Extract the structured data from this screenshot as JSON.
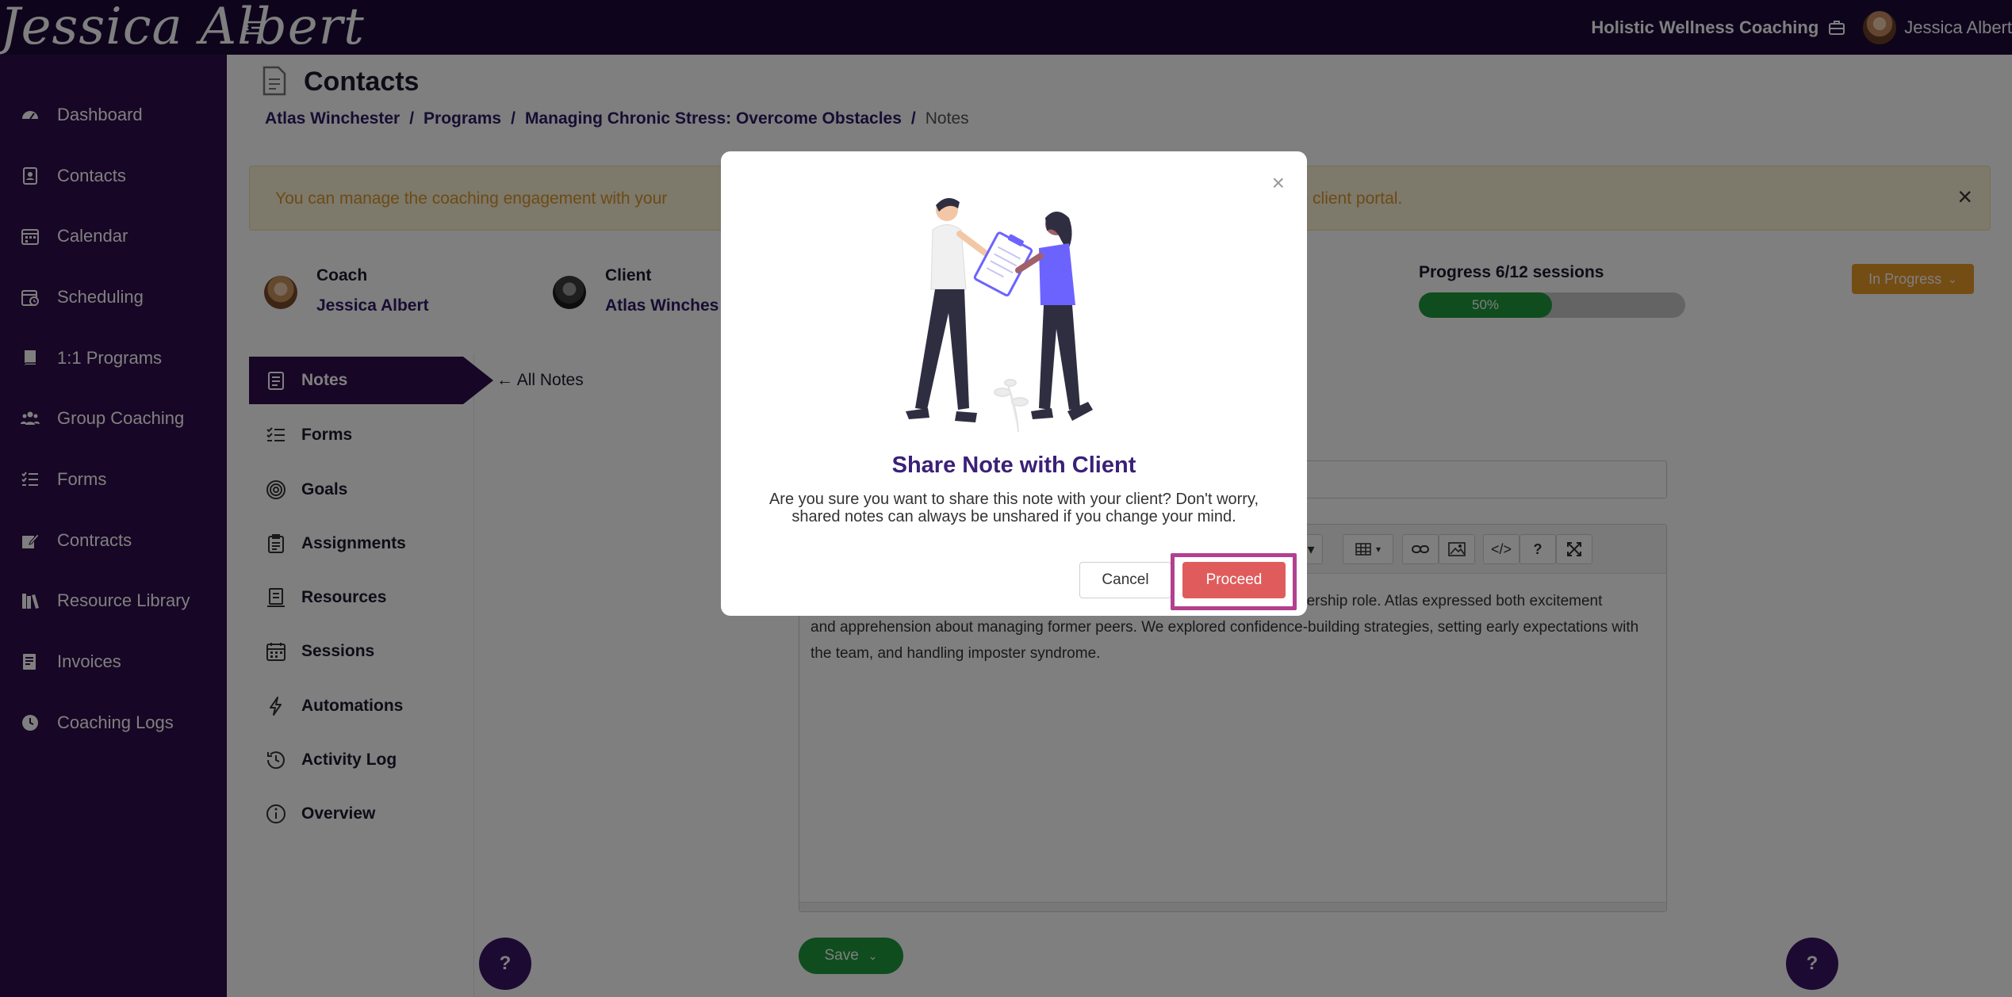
{
  "app": {
    "brand": "Jessica Albert",
    "org_name": "Holistic Wellness Coaching",
    "user_name": "Jessica Albert"
  },
  "sidebar": {
    "items": [
      {
        "label": "Dashboard",
        "icon": "dashboard-icon"
      },
      {
        "label": "Contacts",
        "icon": "contacts-icon"
      },
      {
        "label": "Calendar",
        "icon": "calendar-icon"
      },
      {
        "label": "Scheduling",
        "icon": "scheduling-icon"
      },
      {
        "label": "1:1 Programs",
        "icon": "book-icon"
      },
      {
        "label": "Group Coaching",
        "icon": "group-icon"
      },
      {
        "label": "Forms",
        "icon": "forms-icon"
      },
      {
        "label": "Contracts",
        "icon": "contract-icon"
      },
      {
        "label": "Resource Library",
        "icon": "library-icon"
      },
      {
        "label": "Invoices",
        "icon": "invoice-icon"
      },
      {
        "label": "Coaching Logs",
        "icon": "clock-icon"
      }
    ]
  },
  "page": {
    "title": "Contacts",
    "breadcrumb": {
      "contact": "Atlas Winchester",
      "programs": "Programs",
      "program": "Managing Chronic Stress: Overcome Obstacles",
      "current": "Notes",
      "sep": "/"
    },
    "alert": {
      "text_left": "You can manage the coaching engagement with your",
      "text_right": "the client portal.",
      "close": "×"
    },
    "coach": {
      "role": "Coach",
      "name": "Jessica Albert"
    },
    "client": {
      "role": "Client",
      "name": "Atlas Winches"
    },
    "progress": {
      "label": "Progress 6/12 sessions",
      "percent_text": "50%",
      "fraction": 0.5
    },
    "status": "In Progress",
    "all_notes": "All Notes"
  },
  "subnav": {
    "items": [
      {
        "label": "Notes",
        "icon": "notes-icon",
        "active": true
      },
      {
        "label": "Forms",
        "icon": "forms-list-icon"
      },
      {
        "label": "Goals",
        "icon": "target-icon"
      },
      {
        "label": "Assignments",
        "icon": "clipboard-icon"
      },
      {
        "label": "Resources",
        "icon": "resources-icon"
      },
      {
        "label": "Sessions",
        "icon": "calendar-icon"
      },
      {
        "label": "Automations",
        "icon": "bolt-icon"
      },
      {
        "label": "Activity Log",
        "icon": "history-icon"
      },
      {
        "label": "Overview",
        "icon": "info-icon"
      }
    ]
  },
  "editor": {
    "text_line1": "dership role. Atlas expressed both excitement",
    "text_rest": "and apprehension about managing former peers. We explored confidence-building strategies, setting early expectations with the team, and handling imposter syndrome.",
    "save_label": "Save",
    "toolbar": {
      "code": "</>",
      "help": "?"
    }
  },
  "help": {
    "label": "?"
  },
  "modal": {
    "title": "Share Note with Client",
    "body": "Are you sure you want to share this note with your client? Don't worry, shared notes can always be unshared if you change your mind.",
    "cancel": "Cancel",
    "proceed": "Proceed",
    "close": "×"
  },
  "colors": {
    "topbar": "#1d0b3b",
    "sidebar": "#2e0d4a",
    "accent_green": "#1e9a3c",
    "status_orange": "#e99a2b",
    "proceed_red": "#e05c5c",
    "highlight": "#b3408f"
  }
}
